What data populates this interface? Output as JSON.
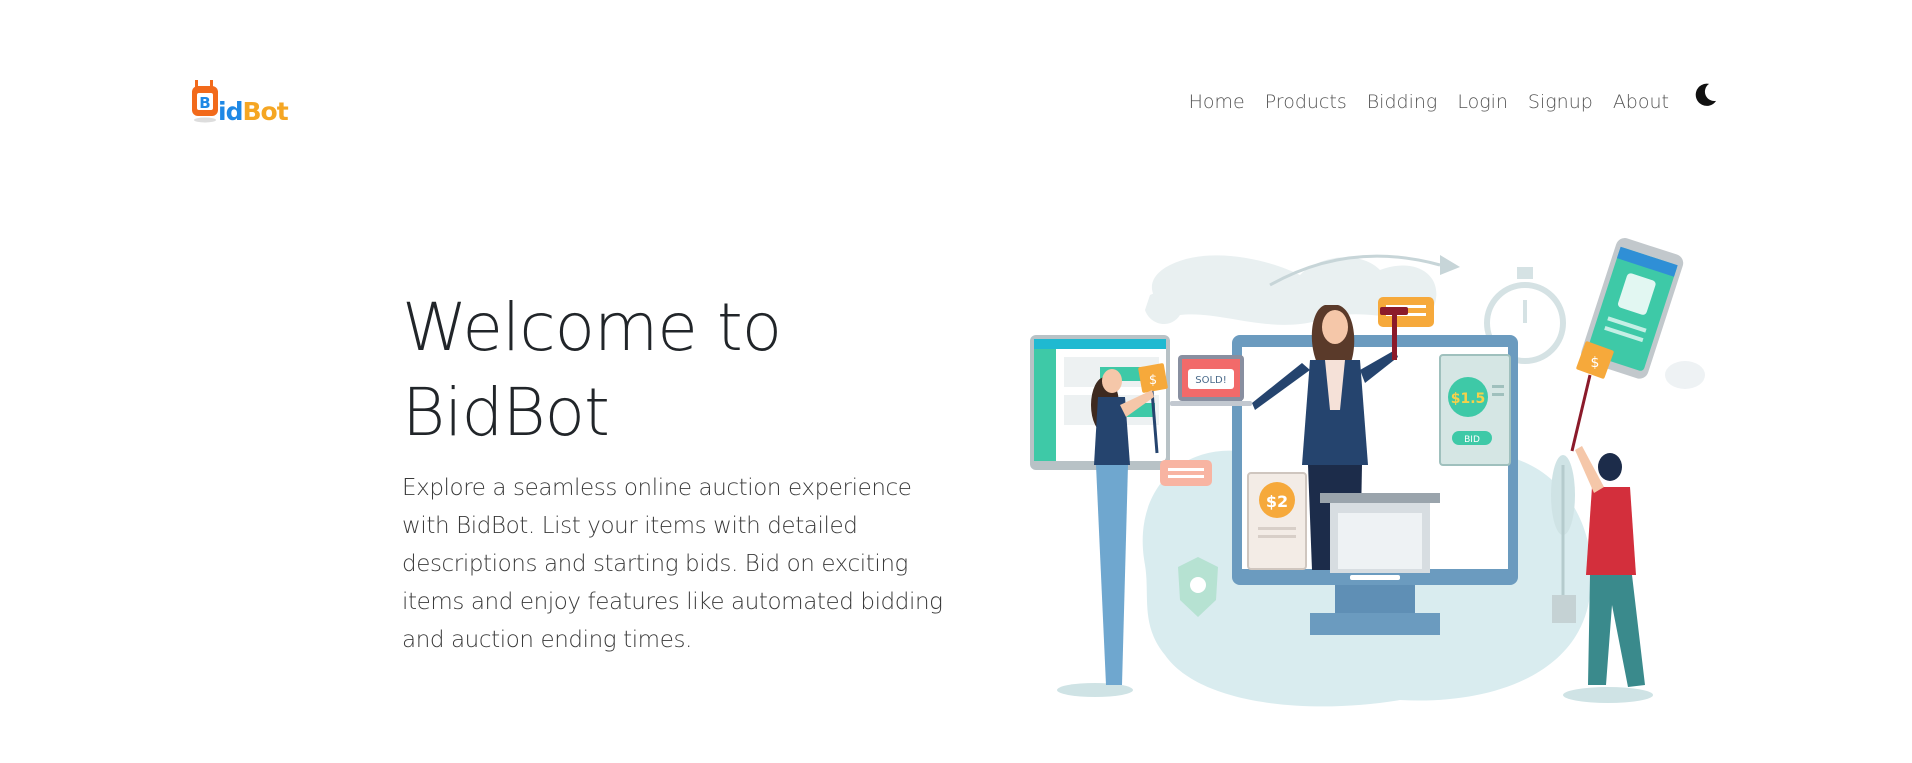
{
  "brand": {
    "logo_b": "B",
    "logo_id": "id",
    "logo_bot": "Bot"
  },
  "nav": {
    "items": [
      {
        "label": "Home"
      },
      {
        "label": "Products"
      },
      {
        "label": "Bidding"
      },
      {
        "label": "Login"
      },
      {
        "label": "Signup"
      },
      {
        "label": "About"
      }
    ],
    "theme_toggle_icon": "moon-icon"
  },
  "hero": {
    "title_line1": "Welcome to",
    "title_line2": "BidBot",
    "description": "Explore a seamless online auction experience with BidBot. List your items with detailed descriptions and starting bids. Bid on exciting items and enjoy features like automated bidding and auction ending times."
  },
  "illustration": {
    "sold_tag": "SOLD!",
    "price_1": "$1.5",
    "price_2": "$2",
    "bid_button": "BID",
    "sign_left": "$",
    "sign_right": "$"
  },
  "colors": {
    "brand_orange": "#f26a1b",
    "brand_blue": "#1e88e5",
    "accent_teal": "#3ec9a7",
    "accent_navy": "#25446e",
    "accent_red": "#d32f3c",
    "accent_amber": "#f6a93b"
  }
}
